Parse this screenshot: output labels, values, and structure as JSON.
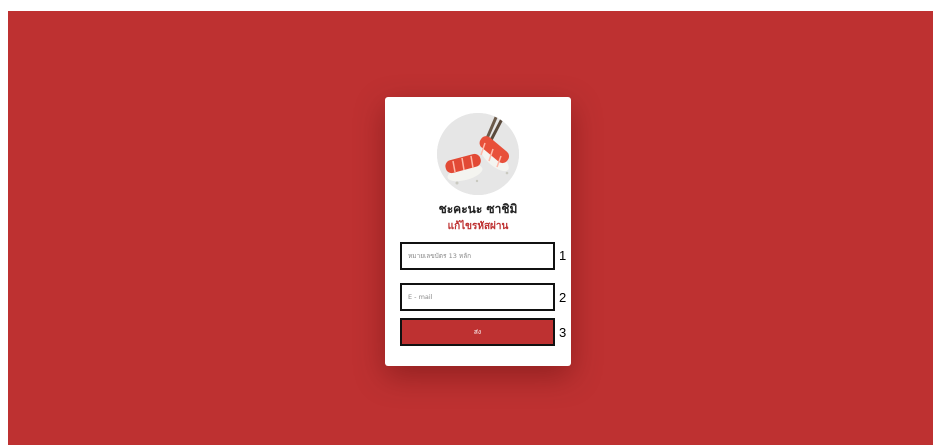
{
  "colors": {
    "primary": "#be3131",
    "card": "#ffffff",
    "outline": "#111111"
  },
  "brand": {
    "name": "ชะคะนะ ซาชิมิ",
    "subtitle": "แก้ไขรหัสผ่าน",
    "logo_icon": "salmon-sushi-chopsticks-icon"
  },
  "form": {
    "id_placeholder": "หมายเลขบัตร 13 หลัก",
    "email_placeholder": "E - mail",
    "submit_label": "ส่ง"
  },
  "annotations": [
    "1",
    "2",
    "3"
  ]
}
